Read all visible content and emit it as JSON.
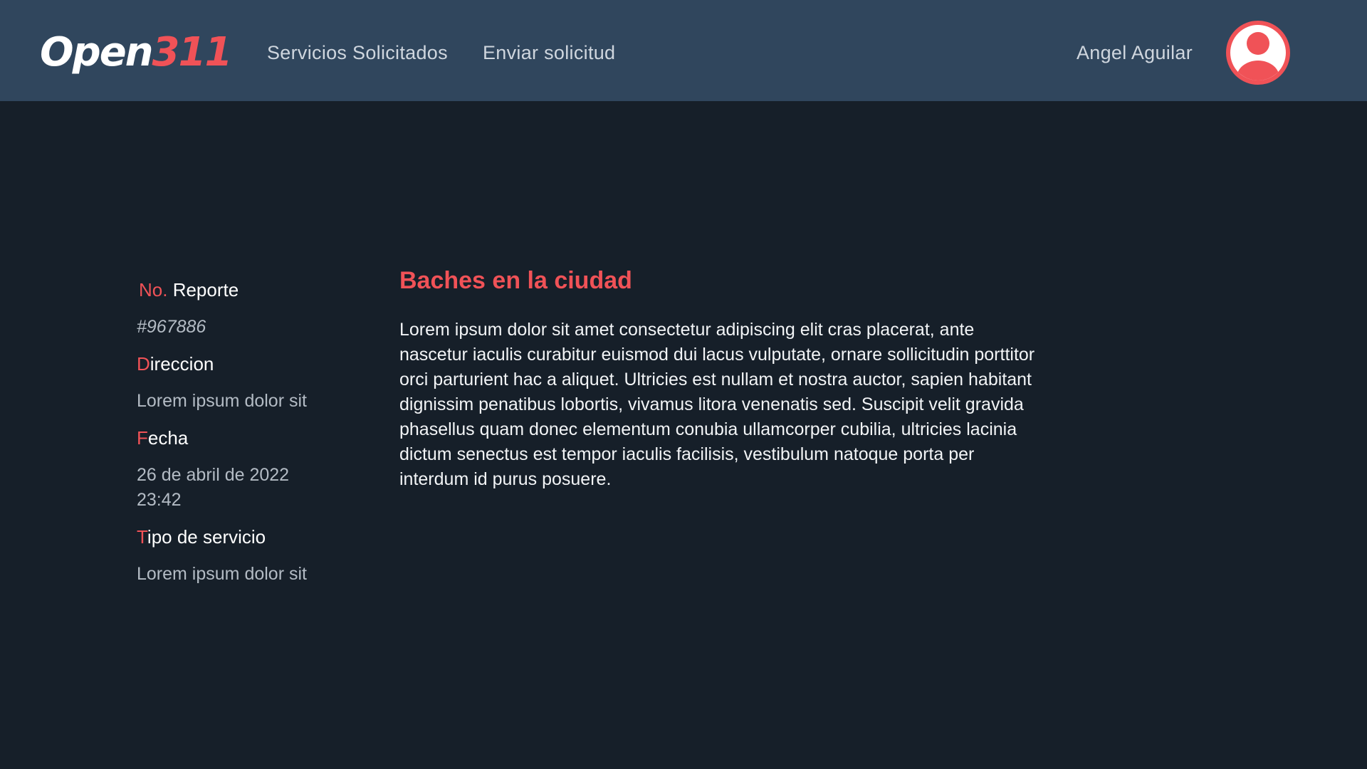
{
  "header": {
    "logo": {
      "part1": "Open",
      "part2": "311"
    },
    "nav": [
      {
        "label": "Servicios Solicitados"
      },
      {
        "label": "Enviar solicitud"
      }
    ],
    "user": {
      "name": "Angel Aguilar",
      "avatar_icon": "user-circle-icon"
    }
  },
  "details": {
    "report": {
      "label_accent": "No.",
      "label_rest": " Reporte",
      "value": "#967886"
    },
    "address": {
      "label_accent": "D",
      "label_rest": "ireccion",
      "value": "Lorem ipsum dolor sit"
    },
    "date": {
      "label_accent": "F",
      "label_rest": "echa",
      "value_line1": "26 de abril de 2022",
      "value_line2": "23:42"
    },
    "service_type": {
      "label_accent": "T",
      "label_rest": "ipo de servicio",
      "value": "Lorem ipsum dolor sit"
    }
  },
  "main": {
    "title": "Baches en la ciudad",
    "description": "Lorem ipsum dolor sit amet consectetur adipiscing elit cras placerat, ante nascetur iaculis curabitur euismod dui lacus vulputate, ornare sollicitudin porttitor orci parturient hac a aliquet. Ultricies est nullam et nostra auctor, sapien habitant dignissim penatibus lobortis, vivamus litora venenatis sed. Suscipit velit gravida phasellus quam donec elementum conubia ullamcorper cubilia, ultricies lacinia dictum senectus est tempor iaculis facilisis, vestibulum natoque porta per interdum id purus posuere."
  },
  "colors": {
    "header_bg": "#30465d",
    "page_bg": "#161f29",
    "accent": "#f05257",
    "nav_text": "#cfd6de",
    "muted_text": "#b3bbc4"
  }
}
